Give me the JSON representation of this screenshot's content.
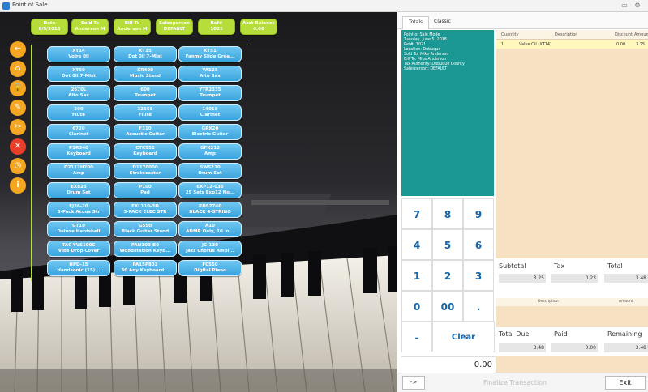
{
  "window": {
    "title": "Point of Sale"
  },
  "topbar": [
    {
      "line1": "Date",
      "line2": "6/5/2018"
    },
    {
      "line1": "Sold To",
      "line2": "Anderson M"
    },
    {
      "line1": "Bill To",
      "line2": "Anderson M"
    },
    {
      "line1": "Salesperson",
      "line2": "DEFAULT"
    },
    {
      "line1": "Ref#",
      "line2": "1021"
    },
    {
      "line1": "Acct Balance",
      "line2": "0.00"
    }
  ],
  "side_icons": [
    "back-arrow-icon",
    "home-icon",
    "lock-icon",
    "wrench-icon",
    "scissors-icon",
    "cancel-icon",
    "clock-icon",
    "info-icon"
  ],
  "products": [
    {
      "code": "XT14",
      "name": "Volre 0ll"
    },
    {
      "code": "XT15",
      "name": "Dot 0ll 7-Mist"
    },
    {
      "code": "XT51",
      "name": "Fanmy Slide Grea..."
    },
    {
      "code": "XT50",
      "name": "Dot 0ll 7-Mist"
    },
    {
      "code": "XR400",
      "name": "Music Stand"
    },
    {
      "code": "YAS25",
      "name": "Alto Sax"
    },
    {
      "code": "2670L",
      "name": "Alto Sax"
    },
    {
      "code": "600",
      "name": "Trumpet"
    },
    {
      "code": "YTR2335",
      "name": "Trumpet"
    },
    {
      "code": "200",
      "name": "Flute"
    },
    {
      "code": "3256S",
      "name": "Flute"
    },
    {
      "code": "14018",
      "name": "Clarinet"
    },
    {
      "code": "6720",
      "name": "Clarinet"
    },
    {
      "code": "F310",
      "name": "Acoustic Guitar"
    },
    {
      "code": "GRX20",
      "name": "Electric Guitar"
    },
    {
      "code": "PSR340",
      "name": "Keyboard"
    },
    {
      "code": "CTK551",
      "name": "Keyboard"
    },
    {
      "code": "GFX212",
      "name": "Amp"
    },
    {
      "code": "D2112H200",
      "name": "Amp"
    },
    {
      "code": "D1170000",
      "name": "Stratocaster"
    },
    {
      "code": "SW5220",
      "name": "Drum Set"
    },
    {
      "code": "EX825",
      "name": "Drum Set"
    },
    {
      "code": "P100",
      "name": "Pad"
    },
    {
      "code": "EXP12-035",
      "name": "25 Sets Exp12 No..."
    },
    {
      "code": "EJ26-20",
      "name": "3-Pack Acous Str"
    },
    {
      "code": "EXL110-3D",
      "name": "3-PACK ELEC STR"
    },
    {
      "code": "RDS2740",
      "name": "BLACK 4-STRING"
    },
    {
      "code": "GT10",
      "name": "Deluxe Hardshell"
    },
    {
      "code": "GS50",
      "name": "Black Guitar Stand"
    },
    {
      "code": "A10",
      "name": "ADMR Only, 10 in..."
    },
    {
      "code": "TAC-YVS100C",
      "name": "Vibe Drop Cover"
    },
    {
      "code": "PAN100-B0",
      "name": "Woodstation Keyb..."
    },
    {
      "code": "JC-130",
      "name": "Jazz Chorus Ampl..."
    },
    {
      "code": "HPD-15",
      "name": "Handsonic (15)..."
    },
    {
      "code": "PA15P802",
      "name": "30 Any Keyboard..."
    },
    {
      "code": "FC550",
      "name": "Digital Piano"
    }
  ],
  "tabs": [
    {
      "label": "Totals"
    },
    {
      "label": "Classic"
    }
  ],
  "info": [
    "Point of Sale Mode",
    "Tuesday, June 5, 2018",
    "Ref#: 1021",
    "Location: Dubuque",
    "Sold To: Mike Anderson",
    "Bill To: Mike Anderson",
    "Tax Authority: Dubuque County",
    "Salesperson: DEFAULT"
  ],
  "order": {
    "headers": {
      "qty": "Quantity",
      "desc": "Description",
      "disc": "Discount",
      "amt": "Amount"
    },
    "rows": [
      {
        "qty": "1",
        "desc": "Valve Oil (XT14)",
        "disc": "0.00",
        "amt": "3.25"
      }
    ]
  },
  "keypad": {
    "k7": "7",
    "k8": "8",
    "k9": "9",
    "k4": "4",
    "k5": "5",
    "k6": "6",
    "k1": "1",
    "k2": "2",
    "k3": "3",
    "k0": "0",
    "k00": "00",
    "kdot": ".",
    "kminus": "-",
    "clear": "Clear"
  },
  "amount_display": "0.00",
  "totals": {
    "subtotal_label": "Subtotal",
    "subtotal": "3.25",
    "tax_label": "Tax",
    "tax": "0.23",
    "total_label": "Total",
    "total": "3.48"
  },
  "payments": {
    "desc_header": "Description",
    "amount_header": "Amount"
  },
  "due": {
    "total_due_label": "Total Due",
    "total_due": "3.48",
    "paid_label": "Paid",
    "paid": "0.00",
    "remaining_label": "Remaining",
    "remaining": "3.48"
  },
  "bottom": {
    "arrow": "->",
    "finalize": "Finalize Transaction",
    "exit": "Exit"
  }
}
